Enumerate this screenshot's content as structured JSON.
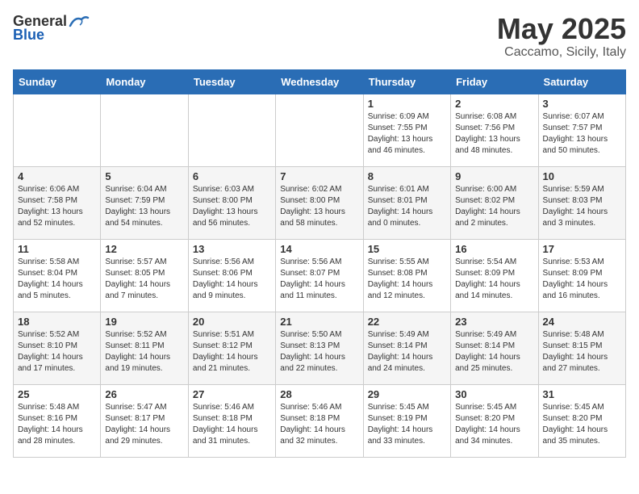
{
  "header": {
    "logo_general": "General",
    "logo_blue": "Blue",
    "month": "May 2025",
    "location": "Caccamo, Sicily, Italy"
  },
  "days_of_week": [
    "Sunday",
    "Monday",
    "Tuesday",
    "Wednesday",
    "Thursday",
    "Friday",
    "Saturday"
  ],
  "weeks": [
    [
      {
        "day": "",
        "sunrise": "",
        "sunset": "",
        "daylight": ""
      },
      {
        "day": "",
        "sunrise": "",
        "sunset": "",
        "daylight": ""
      },
      {
        "day": "",
        "sunrise": "",
        "sunset": "",
        "daylight": ""
      },
      {
        "day": "",
        "sunrise": "",
        "sunset": "",
        "daylight": ""
      },
      {
        "day": "1",
        "sunrise": "Sunrise: 6:09 AM",
        "sunset": "Sunset: 7:55 PM",
        "daylight": "Daylight: 13 hours and 46 minutes."
      },
      {
        "day": "2",
        "sunrise": "Sunrise: 6:08 AM",
        "sunset": "Sunset: 7:56 PM",
        "daylight": "Daylight: 13 hours and 48 minutes."
      },
      {
        "day": "3",
        "sunrise": "Sunrise: 6:07 AM",
        "sunset": "Sunset: 7:57 PM",
        "daylight": "Daylight: 13 hours and 50 minutes."
      }
    ],
    [
      {
        "day": "4",
        "sunrise": "Sunrise: 6:06 AM",
        "sunset": "Sunset: 7:58 PM",
        "daylight": "Daylight: 13 hours and 52 minutes."
      },
      {
        "day": "5",
        "sunrise": "Sunrise: 6:04 AM",
        "sunset": "Sunset: 7:59 PM",
        "daylight": "Daylight: 13 hours and 54 minutes."
      },
      {
        "day": "6",
        "sunrise": "Sunrise: 6:03 AM",
        "sunset": "Sunset: 8:00 PM",
        "daylight": "Daylight: 13 hours and 56 minutes."
      },
      {
        "day": "7",
        "sunrise": "Sunrise: 6:02 AM",
        "sunset": "Sunset: 8:00 PM",
        "daylight": "Daylight: 13 hours and 58 minutes."
      },
      {
        "day": "8",
        "sunrise": "Sunrise: 6:01 AM",
        "sunset": "Sunset: 8:01 PM",
        "daylight": "Daylight: 14 hours and 0 minutes."
      },
      {
        "day": "9",
        "sunrise": "Sunrise: 6:00 AM",
        "sunset": "Sunset: 8:02 PM",
        "daylight": "Daylight: 14 hours and 2 minutes."
      },
      {
        "day": "10",
        "sunrise": "Sunrise: 5:59 AM",
        "sunset": "Sunset: 8:03 PM",
        "daylight": "Daylight: 14 hours and 3 minutes."
      }
    ],
    [
      {
        "day": "11",
        "sunrise": "Sunrise: 5:58 AM",
        "sunset": "Sunset: 8:04 PM",
        "daylight": "Daylight: 14 hours and 5 minutes."
      },
      {
        "day": "12",
        "sunrise": "Sunrise: 5:57 AM",
        "sunset": "Sunset: 8:05 PM",
        "daylight": "Daylight: 14 hours and 7 minutes."
      },
      {
        "day": "13",
        "sunrise": "Sunrise: 5:56 AM",
        "sunset": "Sunset: 8:06 PM",
        "daylight": "Daylight: 14 hours and 9 minutes."
      },
      {
        "day": "14",
        "sunrise": "Sunrise: 5:56 AM",
        "sunset": "Sunset: 8:07 PM",
        "daylight": "Daylight: 14 hours and 11 minutes."
      },
      {
        "day": "15",
        "sunrise": "Sunrise: 5:55 AM",
        "sunset": "Sunset: 8:08 PM",
        "daylight": "Daylight: 14 hours and 12 minutes."
      },
      {
        "day": "16",
        "sunrise": "Sunrise: 5:54 AM",
        "sunset": "Sunset: 8:09 PM",
        "daylight": "Daylight: 14 hours and 14 minutes."
      },
      {
        "day": "17",
        "sunrise": "Sunrise: 5:53 AM",
        "sunset": "Sunset: 8:09 PM",
        "daylight": "Daylight: 14 hours and 16 minutes."
      }
    ],
    [
      {
        "day": "18",
        "sunrise": "Sunrise: 5:52 AM",
        "sunset": "Sunset: 8:10 PM",
        "daylight": "Daylight: 14 hours and 17 minutes."
      },
      {
        "day": "19",
        "sunrise": "Sunrise: 5:52 AM",
        "sunset": "Sunset: 8:11 PM",
        "daylight": "Daylight: 14 hours and 19 minutes."
      },
      {
        "day": "20",
        "sunrise": "Sunrise: 5:51 AM",
        "sunset": "Sunset: 8:12 PM",
        "daylight": "Daylight: 14 hours and 21 minutes."
      },
      {
        "day": "21",
        "sunrise": "Sunrise: 5:50 AM",
        "sunset": "Sunset: 8:13 PM",
        "daylight": "Daylight: 14 hours and 22 minutes."
      },
      {
        "day": "22",
        "sunrise": "Sunrise: 5:49 AM",
        "sunset": "Sunset: 8:14 PM",
        "daylight": "Daylight: 14 hours and 24 minutes."
      },
      {
        "day": "23",
        "sunrise": "Sunrise: 5:49 AM",
        "sunset": "Sunset: 8:14 PM",
        "daylight": "Daylight: 14 hours and 25 minutes."
      },
      {
        "day": "24",
        "sunrise": "Sunrise: 5:48 AM",
        "sunset": "Sunset: 8:15 PM",
        "daylight": "Daylight: 14 hours and 27 minutes."
      }
    ],
    [
      {
        "day": "25",
        "sunrise": "Sunrise: 5:48 AM",
        "sunset": "Sunset: 8:16 PM",
        "daylight": "Daylight: 14 hours and 28 minutes."
      },
      {
        "day": "26",
        "sunrise": "Sunrise: 5:47 AM",
        "sunset": "Sunset: 8:17 PM",
        "daylight": "Daylight: 14 hours and 29 minutes."
      },
      {
        "day": "27",
        "sunrise": "Sunrise: 5:46 AM",
        "sunset": "Sunset: 8:18 PM",
        "daylight": "Daylight: 14 hours and 31 minutes."
      },
      {
        "day": "28",
        "sunrise": "Sunrise: 5:46 AM",
        "sunset": "Sunset: 8:18 PM",
        "daylight": "Daylight: 14 hours and 32 minutes."
      },
      {
        "day": "29",
        "sunrise": "Sunrise: 5:45 AM",
        "sunset": "Sunset: 8:19 PM",
        "daylight": "Daylight: 14 hours and 33 minutes."
      },
      {
        "day": "30",
        "sunrise": "Sunrise: 5:45 AM",
        "sunset": "Sunset: 8:20 PM",
        "daylight": "Daylight: 14 hours and 34 minutes."
      },
      {
        "day": "31",
        "sunrise": "Sunrise: 5:45 AM",
        "sunset": "Sunset: 8:20 PM",
        "daylight": "Daylight: 14 hours and 35 minutes."
      }
    ]
  ]
}
